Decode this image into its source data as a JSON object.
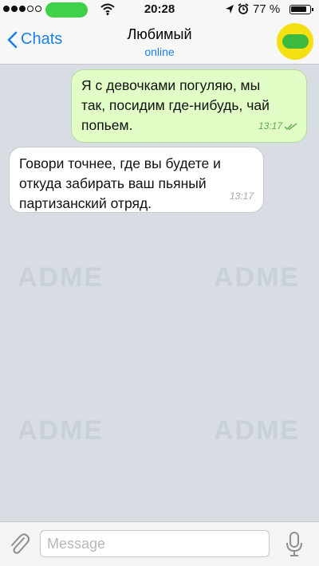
{
  "status_bar": {
    "time": "20:28",
    "battery": "77 %",
    "battery_level": 0.77,
    "signal_bars": 3,
    "signal_total": 5
  },
  "nav": {
    "back_label": "Chats",
    "contact_name": "Любимый",
    "contact_status": "online"
  },
  "messages": [
    {
      "direction": "outgoing",
      "lines": [
        "Я с девочками погуляю, мы",
        "так, посидим где-нибудь, чай",
        "попьем."
      ],
      "time": "13:17",
      "status": "read"
    },
    {
      "direction": "incoming",
      "lines": [
        "Говори точнее, где вы будете и",
        "откуда забирать ваш пьяный",
        "партизанский отряд."
      ],
      "time": "13:17"
    }
  ],
  "watermark": "ADME",
  "input": {
    "placeholder": "Message"
  },
  "colors": {
    "accent": "#1a7fe6",
    "outgoing_bubble": "#e1fec6",
    "incoming_bubble": "#ffffff",
    "chat_background": "#d7dde2",
    "read_check": "#5fa84a"
  }
}
